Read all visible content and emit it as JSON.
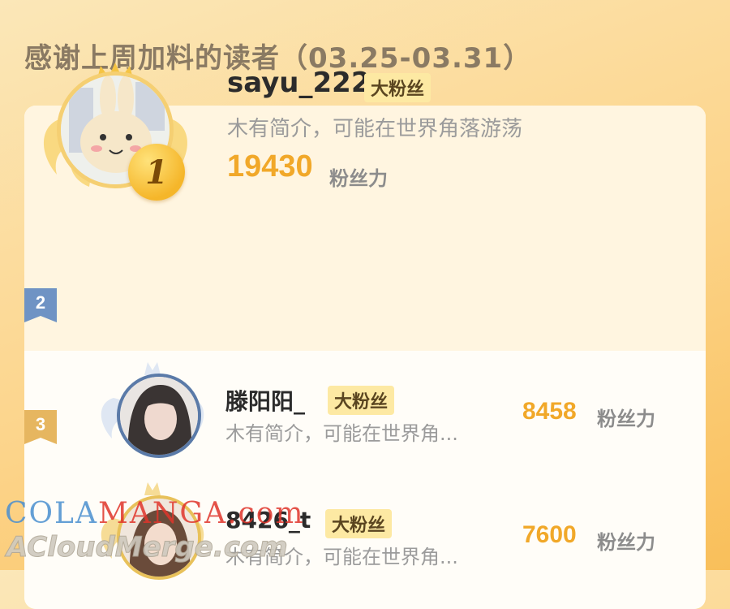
{
  "page": {
    "heading": "感谢上周加料的读者（03.25-03.31）"
  },
  "colors": {
    "accent": "#f1a829",
    "badge_bg": "#fde9a3",
    "rank2_blue": "#6f93c4",
    "gold": "#f5b62a"
  },
  "top_reader": {
    "rank": "1",
    "name": "sayu_222",
    "badge": "大粉丝",
    "intro": "木有简介，可能在世界角落游荡",
    "power": "19430",
    "power_label": "粉丝力",
    "icons": [
      "crown-icon",
      "wings-icon",
      "gold-medal-icon"
    ]
  },
  "readers": [
    {
      "rank": "2",
      "name": "滕阳阳_",
      "badge": "大粉丝",
      "intro": "木有简介，可能在世界角...",
      "power": "8458",
      "power_label": "粉丝力"
    },
    {
      "rank": "3",
      "name": "8426_t",
      "badge": "大粉丝",
      "intro": "木有简介，可能在世界角...",
      "power": "7600",
      "power_label": "粉丝力"
    }
  ],
  "watermark": {
    "line1_a": "COLA",
    "line1_b": "MANGA",
    "line1_c": ".com",
    "line2": "ACloudMerge.com"
  }
}
